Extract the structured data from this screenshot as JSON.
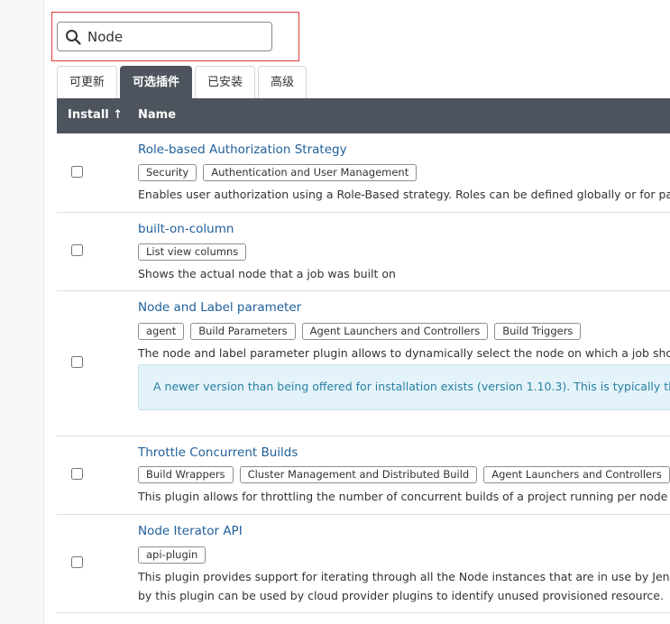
{
  "search": {
    "value": "Node"
  },
  "tabs": [
    {
      "label": "可更新",
      "active": false
    },
    {
      "label": "可选插件",
      "active": true
    },
    {
      "label": "已安装",
      "active": false
    },
    {
      "label": "高级",
      "active": false
    }
  ],
  "table": {
    "headers": {
      "install": "Install ↑",
      "name": "Name"
    },
    "rows": [
      {
        "name": "Role-based Authorization Strategy",
        "labels": [
          "Security",
          "Authentication and User Management"
        ],
        "description": "Enables user authorization using a Role-Based strategy. Roles can be defined globally or for part",
        "checked": false
      },
      {
        "name": "built-on-column",
        "labels": [
          "List view columns"
        ],
        "description": "Shows the actual node that a job was built on",
        "checked": false
      },
      {
        "name": "Node and Label parameter",
        "labels": [
          "agent",
          "Build Parameters",
          "Agent Launchers and Controllers",
          "Build Triggers"
        ],
        "description": "The node and label parameter plugin allows to dynamically select the node on which a job shou",
        "notice": "A newer version than being offered for installation exists (version 1.10.3). This is typically the c",
        "checked": false
      },
      {
        "name": "Throttle Concurrent Builds",
        "labels": [
          "Build Wrappers",
          "Cluster Management and Distributed Build",
          "Agent Launchers and Controllers"
        ],
        "description": "This plugin allows for throttling the number of concurrent builds of a project running per node c",
        "checked": false
      },
      {
        "name": "Node Iterator API",
        "labels": [
          "api-plugin"
        ],
        "description": "This plugin provides support for iterating through all the Node instances that are in use by Jenk",
        "description2": "by this plugin can be used by cloud provider plugins to identify unused provisioned resource.",
        "checked": false
      }
    ]
  },
  "colors": {
    "header_bg": "#4d545d",
    "link": "#1f5f9a",
    "highlight_border": "#e03b3b",
    "notice_bg": "#e3f3f9",
    "notice_text": "#2a7fa3"
  }
}
